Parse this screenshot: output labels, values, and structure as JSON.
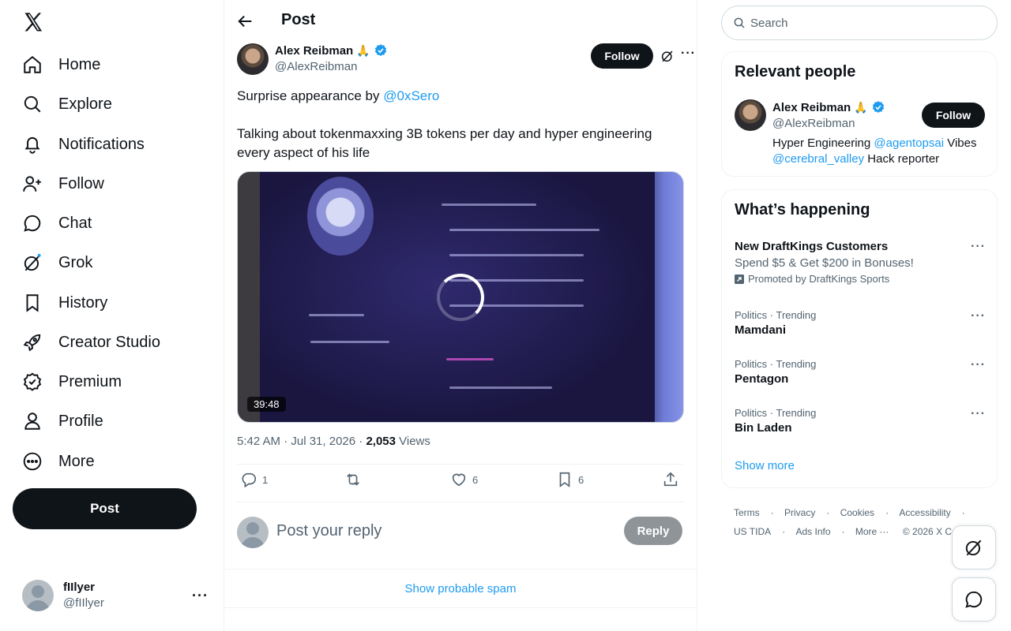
{
  "nav": {
    "items": [
      {
        "label": "Home",
        "icon": "home-icon"
      },
      {
        "label": "Explore",
        "icon": "search-icon"
      },
      {
        "label": "Notifications",
        "icon": "bell-icon"
      },
      {
        "label": "Follow",
        "icon": "add-user-icon"
      },
      {
        "label": "Chat",
        "icon": "chat-icon"
      },
      {
        "label": "Grok",
        "icon": "grok-icon"
      },
      {
        "label": "History",
        "icon": "bookmark-icon"
      },
      {
        "label": "Creator Studio",
        "icon": "rocket-icon"
      },
      {
        "label": "Premium",
        "icon": "verified-icon"
      },
      {
        "label": "Profile",
        "icon": "person-icon"
      },
      {
        "label": "More",
        "icon": "more-circle-icon"
      }
    ],
    "post_label": "Post",
    "account": {
      "name": "fIIlyer",
      "handle": "@fIIlyer"
    }
  },
  "header": {
    "title": "Post"
  },
  "tweet": {
    "author_name": "Alex Reibman",
    "author_emoji": "🙏",
    "author_handle": "@AlexReibman",
    "follow_label": "Follow",
    "text_line1_prefix": "Surprise appearance by ",
    "text_line1_mention": "@0xSero",
    "text_line2": "Talking about tokenmaxxing 3B tokens per day and hyper engineering every aspect of his life",
    "video_duration": "39:48",
    "timestamp": "5:42 AM · Jul 31, 2026 · ",
    "views_count": "2,053",
    "views_label": " Views",
    "replies": "1",
    "likes": "6",
    "bookmarks": "6"
  },
  "reply": {
    "placeholder": "Post your reply",
    "button": "Reply"
  },
  "spam_label": "Show probable spam",
  "search": {
    "placeholder": "Search"
  },
  "relevant": {
    "title": "Relevant people",
    "name": "Alex Reibman",
    "emoji": "🙏",
    "handle": "@AlexReibman",
    "follow_label": "Follow",
    "bio_1": "Hyper Engineering ",
    "bio_mention_1": "@agentopsai",
    "bio_2": " Vibes ",
    "bio_mention_2": "@cerebral_valley",
    "bio_3": " Hack reporter"
  },
  "happening": {
    "title": "What’s happening",
    "promo": {
      "title": "New DraftKings Customers",
      "subtitle": "Spend $5 & Get $200 in Bonuses!",
      "promoted": "Promoted by DraftKings Sports"
    },
    "trends": [
      {
        "context": "Politics · Trending",
        "title": "Mamdani"
      },
      {
        "context": "Politics · Trending",
        "title": "Pentagon"
      },
      {
        "context": "Politics · Trending",
        "title": "Bin Laden"
      }
    ],
    "show_more": "Show more"
  },
  "footer": {
    "links": [
      "Terms",
      "Privacy",
      "Cookies",
      "Accessibility",
      "US TIDA",
      "Ads Info",
      "More ···"
    ],
    "copyright": "© 2026 X Corp."
  },
  "colors": {
    "accent": "#1d9bf0",
    "text": "#0f1419",
    "muted": "#536471",
    "verified": "#1d9bf0"
  }
}
